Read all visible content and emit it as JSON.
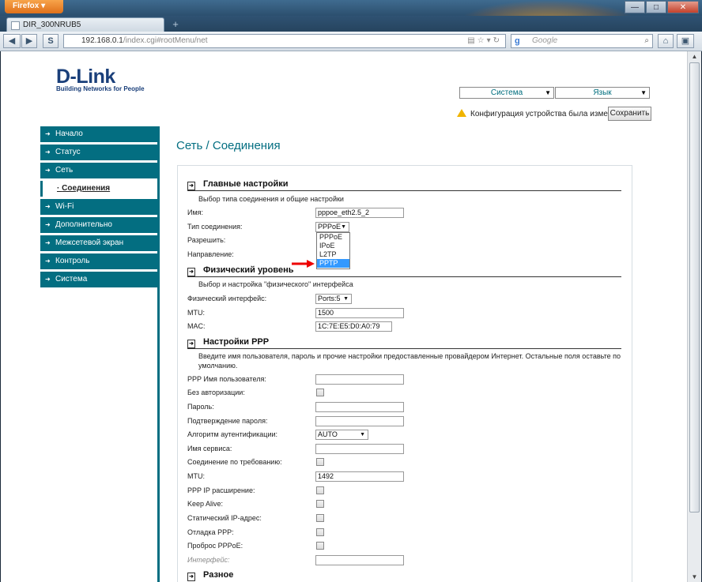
{
  "browser": {
    "firefox_button": "Firefox",
    "tab_title": "DIR_300NRUB5",
    "new_tab": "+",
    "url_host": "192.168.0.1",
    "url_path": "/index.cgi#rootMenu/net",
    "search_placeholder": "Google",
    "window_controls": [
      "—",
      "□",
      "✕"
    ]
  },
  "header": {
    "logo_text": "D-Link",
    "logo_tagline": "Building Networks for People",
    "system_dropdown": "Система",
    "language_dropdown": "Язык",
    "warning_text": "Конфигурация устройства была изменена",
    "save_button": "Сохранить"
  },
  "sidebar": {
    "items": [
      {
        "label": "Начало"
      },
      {
        "label": "Статус"
      },
      {
        "label": "Сеть"
      },
      {
        "label": "Соединения"
      },
      {
        "label": "Wi-Fi"
      },
      {
        "label": "Дополнительно"
      },
      {
        "label": "Межсетевой экран"
      },
      {
        "label": "Контроль"
      },
      {
        "label": "Система"
      }
    ]
  },
  "page": {
    "title": "Сеть  /  Соединения"
  },
  "main_settings": {
    "heading": "Главные настройки",
    "description": "Выбор типа соединения и общие настройки",
    "name_label": "Имя:",
    "name_value": "pppoe_eth2.5_2",
    "type_label": "Тип соединения:",
    "type_value": "PPPoE",
    "type_options": [
      "PPPoE",
      "IPoE",
      "L2TP",
      "PPTP"
    ],
    "type_highlighted": "PPTP",
    "enable_label": "Разрешить:",
    "direction_label": "Направление:"
  },
  "physical": {
    "heading": "Физический уровень",
    "description": "Выбор и настройка \"физического\" интерфейса",
    "interface_label": "Физический интерфейс:",
    "interface_value": "Ports:5",
    "mtu_label": "MTU:",
    "mtu_value": "1500",
    "mac_label": "MAC:",
    "mac_value": "1C:7E:E5:D0:A0:79"
  },
  "ppp": {
    "heading": "Настройки PPP",
    "description_line1": "Введите имя пользователя, пароль и прочие настройки предоставленные провайдером Интернет. Остальные поля оставьте по",
    "description_line2": "умолчанию.",
    "username_label": "PPP Имя пользователя:",
    "noauth_label": "Без авторизации:",
    "password_label": "Пароль:",
    "password_confirm_label": "Подтверждение пароля:",
    "auth_algo_label": "Алгоритм аутентификации:",
    "auth_algo_value": "AUTO",
    "service_label": "Имя сервиса:",
    "ondemand_label": "Соединение по требованию:",
    "mtu_label": "MTU:",
    "mtu_value": "1492",
    "ipext_label": "PPP IP расширение:",
    "keepalive_label": "Keep Alive:",
    "static_ip_label": "Статический IP-адрес:",
    "debug_label": "Отладка PPP:",
    "passthrough_label": "Проброс PPPoE:",
    "interface_label": "Интерфейс:"
  },
  "misc": {
    "heading": "Разное"
  },
  "colors": {
    "accent": "#036e81",
    "title": "#036e81",
    "highlight": "#3399ff",
    "warning": "#f0b400"
  }
}
